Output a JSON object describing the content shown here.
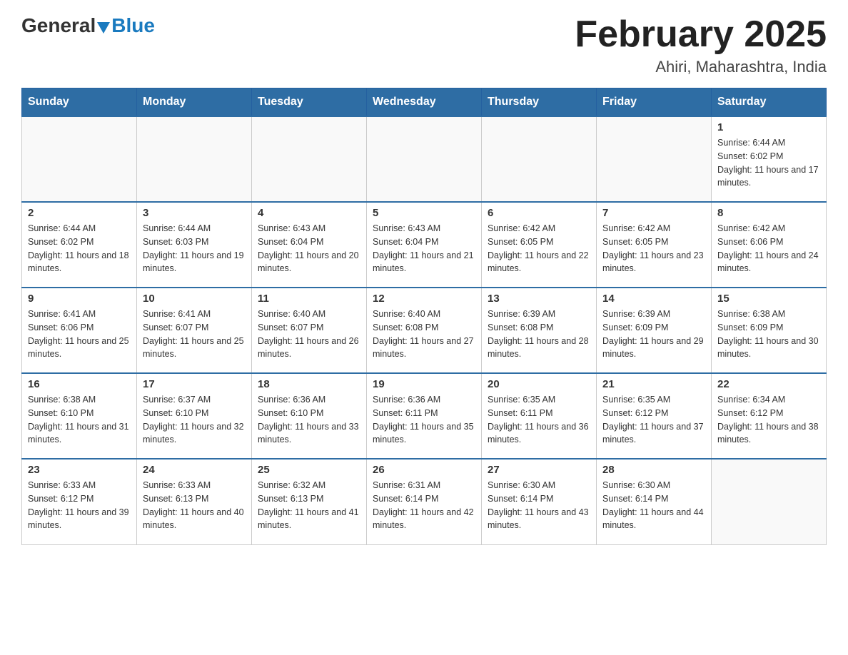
{
  "logo": {
    "text_general": "General",
    "text_blue": "Blue",
    "tagline": ""
  },
  "header": {
    "title": "February 2025",
    "subtitle": "Ahiri, Maharashtra, India"
  },
  "days_of_week": [
    "Sunday",
    "Monday",
    "Tuesday",
    "Wednesday",
    "Thursday",
    "Friday",
    "Saturday"
  ],
  "weeks": [
    [
      {
        "day": "",
        "info": ""
      },
      {
        "day": "",
        "info": ""
      },
      {
        "day": "",
        "info": ""
      },
      {
        "day": "",
        "info": ""
      },
      {
        "day": "",
        "info": ""
      },
      {
        "day": "",
        "info": ""
      },
      {
        "day": "1",
        "info": "Sunrise: 6:44 AM\nSunset: 6:02 PM\nDaylight: 11 hours and 17 minutes."
      }
    ],
    [
      {
        "day": "2",
        "info": "Sunrise: 6:44 AM\nSunset: 6:02 PM\nDaylight: 11 hours and 18 minutes."
      },
      {
        "day": "3",
        "info": "Sunrise: 6:44 AM\nSunset: 6:03 PM\nDaylight: 11 hours and 19 minutes."
      },
      {
        "day": "4",
        "info": "Sunrise: 6:43 AM\nSunset: 6:04 PM\nDaylight: 11 hours and 20 minutes."
      },
      {
        "day": "5",
        "info": "Sunrise: 6:43 AM\nSunset: 6:04 PM\nDaylight: 11 hours and 21 minutes."
      },
      {
        "day": "6",
        "info": "Sunrise: 6:42 AM\nSunset: 6:05 PM\nDaylight: 11 hours and 22 minutes."
      },
      {
        "day": "7",
        "info": "Sunrise: 6:42 AM\nSunset: 6:05 PM\nDaylight: 11 hours and 23 minutes."
      },
      {
        "day": "8",
        "info": "Sunrise: 6:42 AM\nSunset: 6:06 PM\nDaylight: 11 hours and 24 minutes."
      }
    ],
    [
      {
        "day": "9",
        "info": "Sunrise: 6:41 AM\nSunset: 6:06 PM\nDaylight: 11 hours and 25 minutes."
      },
      {
        "day": "10",
        "info": "Sunrise: 6:41 AM\nSunset: 6:07 PM\nDaylight: 11 hours and 25 minutes."
      },
      {
        "day": "11",
        "info": "Sunrise: 6:40 AM\nSunset: 6:07 PM\nDaylight: 11 hours and 26 minutes."
      },
      {
        "day": "12",
        "info": "Sunrise: 6:40 AM\nSunset: 6:08 PM\nDaylight: 11 hours and 27 minutes."
      },
      {
        "day": "13",
        "info": "Sunrise: 6:39 AM\nSunset: 6:08 PM\nDaylight: 11 hours and 28 minutes."
      },
      {
        "day": "14",
        "info": "Sunrise: 6:39 AM\nSunset: 6:09 PM\nDaylight: 11 hours and 29 minutes."
      },
      {
        "day": "15",
        "info": "Sunrise: 6:38 AM\nSunset: 6:09 PM\nDaylight: 11 hours and 30 minutes."
      }
    ],
    [
      {
        "day": "16",
        "info": "Sunrise: 6:38 AM\nSunset: 6:10 PM\nDaylight: 11 hours and 31 minutes."
      },
      {
        "day": "17",
        "info": "Sunrise: 6:37 AM\nSunset: 6:10 PM\nDaylight: 11 hours and 32 minutes."
      },
      {
        "day": "18",
        "info": "Sunrise: 6:36 AM\nSunset: 6:10 PM\nDaylight: 11 hours and 33 minutes."
      },
      {
        "day": "19",
        "info": "Sunrise: 6:36 AM\nSunset: 6:11 PM\nDaylight: 11 hours and 35 minutes."
      },
      {
        "day": "20",
        "info": "Sunrise: 6:35 AM\nSunset: 6:11 PM\nDaylight: 11 hours and 36 minutes."
      },
      {
        "day": "21",
        "info": "Sunrise: 6:35 AM\nSunset: 6:12 PM\nDaylight: 11 hours and 37 minutes."
      },
      {
        "day": "22",
        "info": "Sunrise: 6:34 AM\nSunset: 6:12 PM\nDaylight: 11 hours and 38 minutes."
      }
    ],
    [
      {
        "day": "23",
        "info": "Sunrise: 6:33 AM\nSunset: 6:12 PM\nDaylight: 11 hours and 39 minutes."
      },
      {
        "day": "24",
        "info": "Sunrise: 6:33 AM\nSunset: 6:13 PM\nDaylight: 11 hours and 40 minutes."
      },
      {
        "day": "25",
        "info": "Sunrise: 6:32 AM\nSunset: 6:13 PM\nDaylight: 11 hours and 41 minutes."
      },
      {
        "day": "26",
        "info": "Sunrise: 6:31 AM\nSunset: 6:14 PM\nDaylight: 11 hours and 42 minutes."
      },
      {
        "day": "27",
        "info": "Sunrise: 6:30 AM\nSunset: 6:14 PM\nDaylight: 11 hours and 43 minutes."
      },
      {
        "day": "28",
        "info": "Sunrise: 6:30 AM\nSunset: 6:14 PM\nDaylight: 11 hours and 44 minutes."
      },
      {
        "day": "",
        "info": ""
      }
    ]
  ]
}
